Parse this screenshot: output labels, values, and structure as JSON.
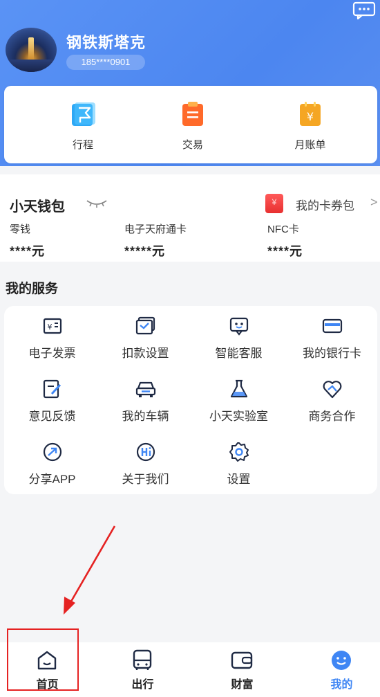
{
  "colors": {
    "brand_blue": "#4c86f0",
    "accent_red": "#e52222",
    "active_tab": "#3f86f4"
  },
  "profile": {
    "name": "钢铁斯塔克",
    "phone": "185****0901",
    "avatar_icon": "avatar-photo"
  },
  "quick_actions": [
    {
      "label": "行程",
      "icon": "trip-flag-icon"
    },
    {
      "label": "交易",
      "icon": "transaction-clipboard-icon"
    },
    {
      "label": "月账单",
      "icon": "monthly-bill-icon"
    }
  ],
  "wallet": {
    "title": "小天钱包",
    "card_pack_label": "我的卡券包",
    "card_pack_yen": "¥",
    "chevron": ">",
    "columns": [
      {
        "label": "零钱",
        "value": "****元"
      },
      {
        "label": "电子天府通卡",
        "value": "*****元"
      },
      {
        "label": "NFC卡",
        "value": "****元"
      }
    ]
  },
  "services": {
    "title": "我的服务",
    "items": [
      {
        "label": "电子发票",
        "icon": "invoice-icon"
      },
      {
        "label": "扣款设置",
        "icon": "deduction-settings-icon"
      },
      {
        "label": "智能客服",
        "icon": "smart-service-icon"
      },
      {
        "label": "我的银行卡",
        "icon": "bank-card-icon"
      },
      {
        "label": "意见反馈",
        "icon": "feedback-icon"
      },
      {
        "label": "我的车辆",
        "icon": "vehicle-icon"
      },
      {
        "label": "小天实验室",
        "icon": "lab-flask-icon"
      },
      {
        "label": "商务合作",
        "icon": "business-heart-icon"
      },
      {
        "label": "分享APP",
        "icon": "share-app-icon"
      },
      {
        "label": "关于我们",
        "icon": "about-us-hi-icon"
      },
      {
        "label": "设置",
        "icon": "settings-gear-icon"
      }
    ]
  },
  "tabs": [
    {
      "label": "首页",
      "icon": "home-icon",
      "active": false
    },
    {
      "label": "出行",
      "icon": "bus-icon",
      "active": false
    },
    {
      "label": "财富",
      "icon": "wallet-icon",
      "active": false
    },
    {
      "label": "我的",
      "icon": "smiley-icon",
      "active": true
    }
  ]
}
